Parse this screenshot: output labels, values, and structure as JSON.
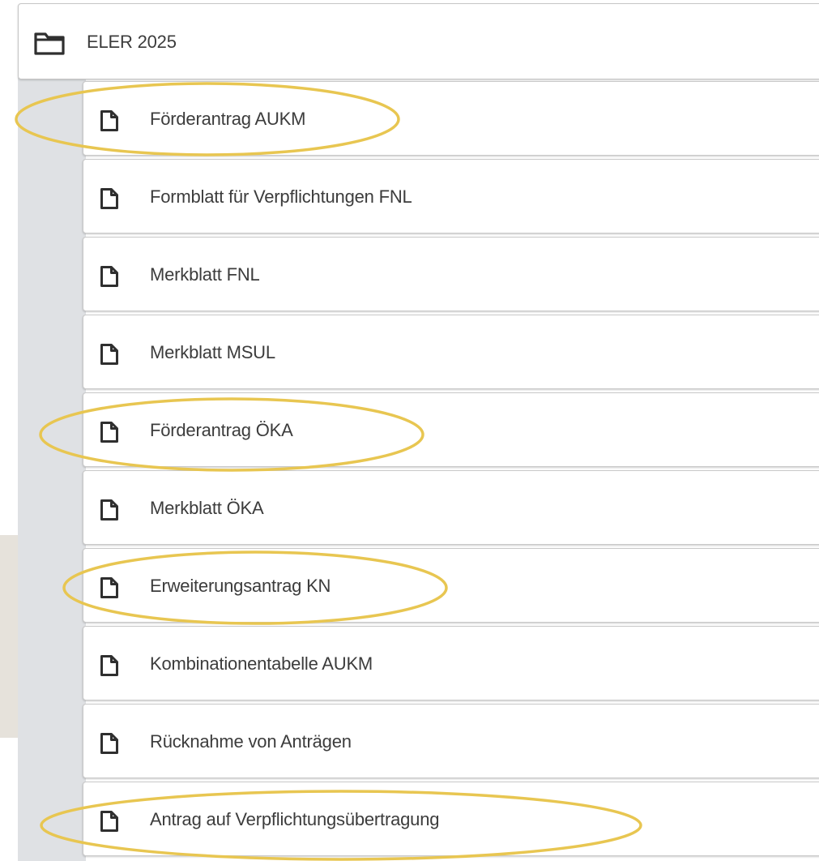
{
  "folder": {
    "label": "ELER 2025",
    "icon": "folder-icon"
  },
  "documents": [
    {
      "label": "Förderantrag AUKM",
      "icon": "document-icon",
      "highlighted": true
    },
    {
      "label": "Formblatt für Verpflichtungen FNL",
      "icon": "document-icon",
      "highlighted": false
    },
    {
      "label": "Merkblatt FNL",
      "icon": "document-icon",
      "highlighted": false
    },
    {
      "label": "Merkblatt MSUL",
      "icon": "document-icon",
      "highlighted": false
    },
    {
      "label": "Förderantrag ÖKA",
      "icon": "document-icon",
      "highlighted": true
    },
    {
      "label": "Merkblatt ÖKA",
      "icon": "document-icon",
      "highlighted": false
    },
    {
      "label": "Erweiterungsantrag KN",
      "icon": "document-icon",
      "highlighted": true
    },
    {
      "label": "Kombinationentabelle AUKM",
      "icon": "document-icon",
      "highlighted": false
    },
    {
      "label": "Rücknahme von Anträgen",
      "icon": "document-icon",
      "highlighted": false
    },
    {
      "label": "Antrag auf Verpflichtungsübertragung",
      "icon": "document-icon",
      "highlighted": true
    }
  ],
  "colors": {
    "highlight_ellipse": "#e8c651",
    "indent_panel": "#dfe1e4",
    "row_border": "#c9c9c9",
    "text": "#3c3c3c"
  }
}
